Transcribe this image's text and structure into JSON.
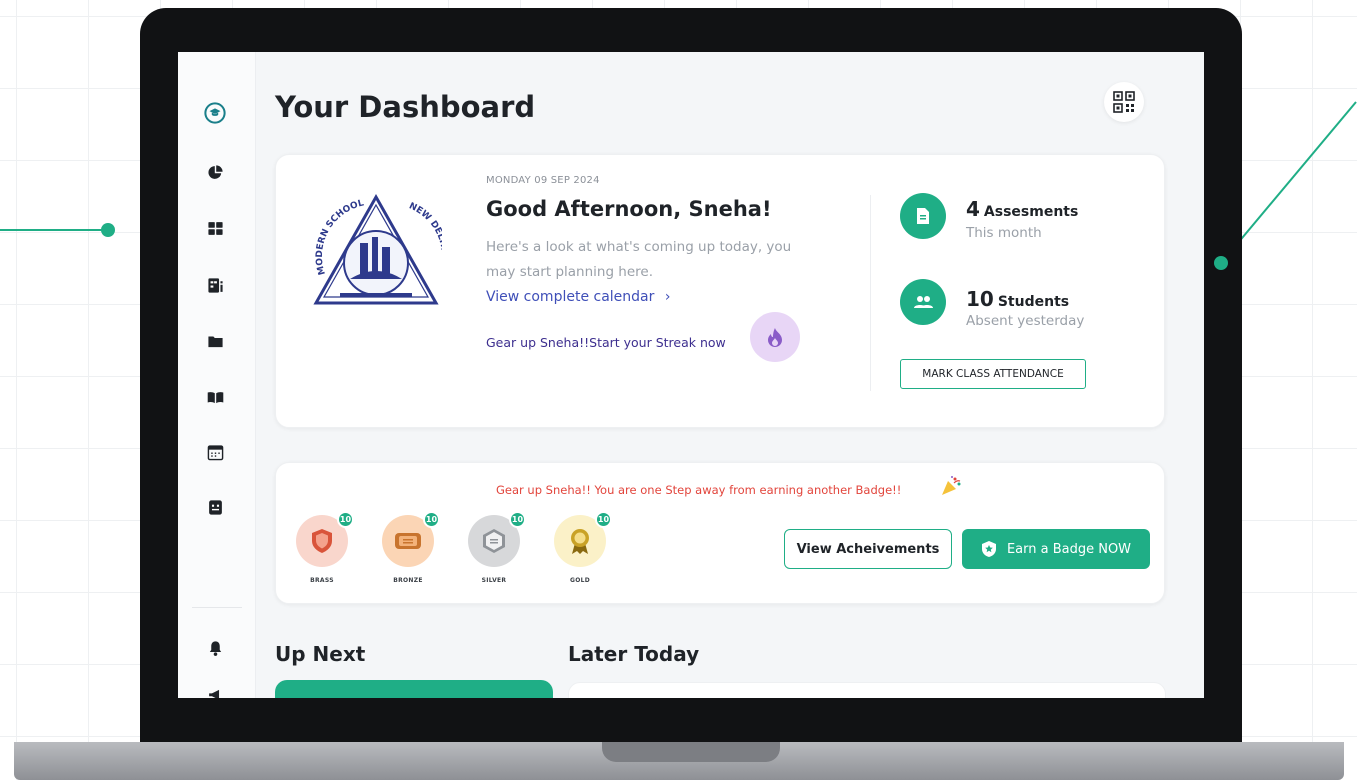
{
  "colors": {
    "accent": "#1fae86",
    "link": "#3f4fb8",
    "warning_text": "#e2453c",
    "streak_text": "#3d2f8f",
    "streak_bg": "#e8d6f6"
  },
  "header": {
    "title": "Your Dashboard",
    "qr_icon": "qr-code-icon"
  },
  "sidebar": {
    "items": [
      {
        "icon": "graduation-cap-icon",
        "active": true
      },
      {
        "icon": "pie-chart-icon"
      },
      {
        "icon": "grid-icon"
      },
      {
        "icon": "report-icon"
      },
      {
        "icon": "folder-icon"
      },
      {
        "icon": "book-icon"
      },
      {
        "icon": "calendar-icon"
      },
      {
        "icon": "chat-icon"
      },
      {
        "icon": "bell-icon"
      },
      {
        "icon": "megaphone-icon"
      }
    ]
  },
  "greeting_card": {
    "date": "MONDAY 09 SEP 2024",
    "greeting": "Good Afternoon, Sneha!",
    "subtitle": "Here's a look at what's coming up today, you may start planning here.",
    "calendar_link": "View complete calendar",
    "streak_text": "Gear up Sneha!!Start your Streak now",
    "logo_top_text": "MODERN SCHOOL",
    "logo_right_text": "NEW DELHI"
  },
  "stats": {
    "assessments": {
      "count": "4",
      "label": "Assesments",
      "sub": "This month"
    },
    "students": {
      "count": "10",
      "label": "Students",
      "sub": "Absent yesterday"
    },
    "attendance_button": "MARK CLASS ATTENDANCE"
  },
  "badges": {
    "message": "Gear up Sneha!! You are one Step away from earning another Badge!!",
    "items": [
      {
        "name": "BRASS",
        "count": "10",
        "bg": "#f9d6cc",
        "medal": "#d9543a"
      },
      {
        "name": "BRONZE",
        "count": "10",
        "bg": "#fbd5b5",
        "medal": "#c8742e"
      },
      {
        "name": "SILVER",
        "count": "10",
        "bg": "#d7d8da",
        "medal": "#8f9398"
      },
      {
        "name": "GOLD",
        "count": "10",
        "bg": "#fbf1c8",
        "medal": "#c9a227"
      }
    ],
    "view_button": "View Acheivements",
    "earn_button": "Earn a Badge NOW"
  },
  "sections": {
    "up_next": "Up Next",
    "later_today": "Later Today"
  }
}
